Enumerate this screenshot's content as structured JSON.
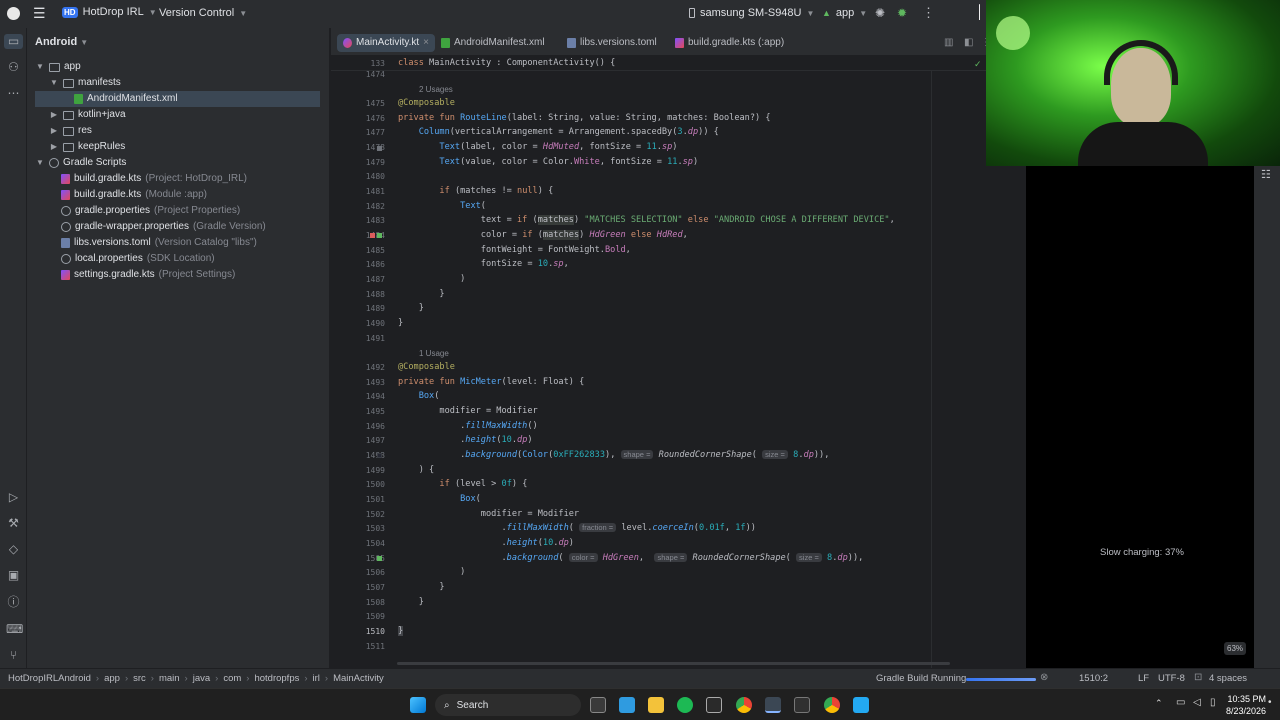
{
  "titlebar": {
    "project_badge": "HD",
    "project_name": "HotDrop IRL",
    "vcs": "Version Control",
    "device": "samsung SM-S948U",
    "run_config": "app"
  },
  "project_panel": {
    "view": "Android",
    "items": [
      {
        "label": "app",
        "hint": ""
      },
      {
        "label": "manifests",
        "hint": ""
      },
      {
        "label": "AndroidManifest.xml",
        "hint": ""
      },
      {
        "label": "kotlin+java",
        "hint": ""
      },
      {
        "label": "res",
        "hint": ""
      },
      {
        "label": "keepRules",
        "hint": ""
      },
      {
        "label": "Gradle Scripts",
        "hint": ""
      },
      {
        "label": "build.gradle.kts",
        "hint": "(Project: HotDrop_IRL)"
      },
      {
        "label": "build.gradle.kts",
        "hint": "(Module :app)"
      },
      {
        "label": "gradle.properties",
        "hint": "(Project Properties)"
      },
      {
        "label": "gradle-wrapper.properties",
        "hint": "(Gradle Version)"
      },
      {
        "label": "libs.versions.toml",
        "hint": "(Version Catalog \"libs\")"
      },
      {
        "label": "local.properties",
        "hint": "(SDK Location)"
      },
      {
        "label": "settings.gradle.kts",
        "hint": "(Project Settings)"
      }
    ]
  },
  "tabs": [
    {
      "label": "MainActivity.kt",
      "close": "×"
    },
    {
      "label": "AndroidManifest.xml"
    },
    {
      "label": "libs.versions.toml"
    },
    {
      "label": "build.gradle.kts (:app)"
    }
  ],
  "editor": {
    "sticky_line_no": "133",
    "sticky_code": "class MainActivity : ComponentActivity() {",
    "usage1": "2 Usages",
    "usage2": "1 Usage",
    "line_numbers": [
      "1474",
      "1475",
      "1476",
      "1477",
      "1478",
      "1479",
      "1480",
      "1481",
      "1482",
      "1483",
      "1484",
      "1485",
      "1486",
      "1487",
      "1488",
      "1489",
      "1490",
      "1491",
      "1492",
      "1493",
      "1494",
      "1495",
      "1496",
      "1497",
      "1498",
      "1499",
      "1500",
      "1501",
      "1502",
      "1503",
      "1504",
      "1505",
      "1506",
      "1507",
      "1508",
      "1509",
      "1510",
      "1511"
    ]
  },
  "right_panel": {
    "charging": "Slow charging: 37%",
    "zoom": "63%"
  },
  "statusbar": {
    "breadcrumbs": [
      "HotDropIRLAndroid",
      "app",
      "src",
      "main",
      "java",
      "com",
      "hotdropfps",
      "irl",
      "MainActivity"
    ],
    "task": "Gradle Build Running",
    "position": "1510:2",
    "line_sep": "LF",
    "encoding": "UTF-8",
    "indent": "4 spaces"
  },
  "taskbar": {
    "search": "Search",
    "time": "10:35 PM",
    "date": "8/23/2026"
  },
  "colors": {
    "accent": "#3574f0",
    "green_mark": "#5fb85f",
    "red_mark": "#db5c5c"
  }
}
